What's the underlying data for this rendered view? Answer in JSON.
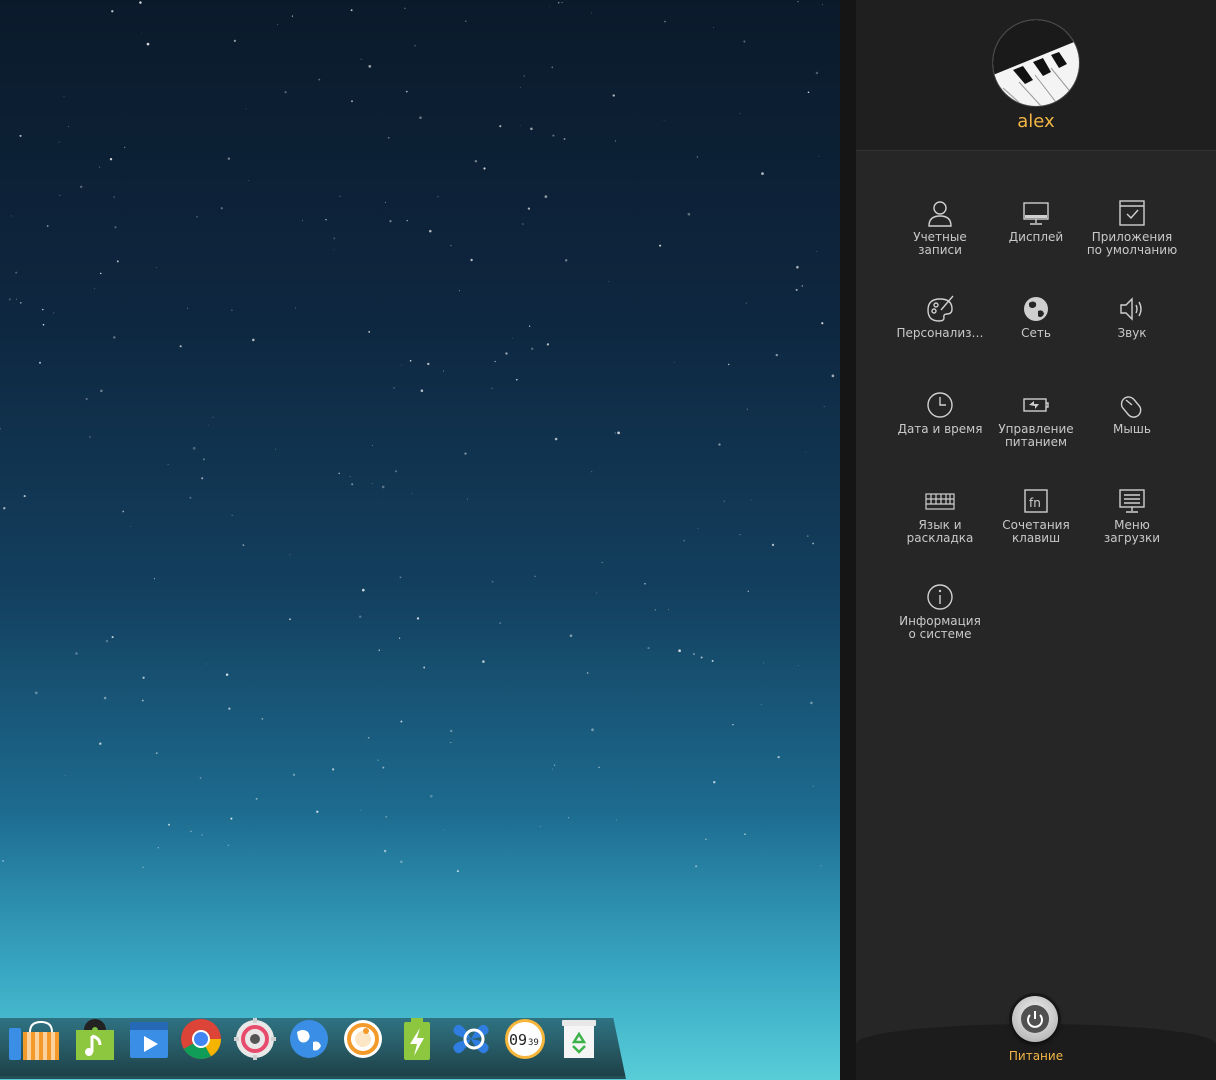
{
  "panel": {
    "username": "alex",
    "power_label": "Питание",
    "accent_color": "#f2b545",
    "modules": [
      {
        "label": "Учетные\nзаписи",
        "icon": "user-accounts-icon"
      },
      {
        "label": "Дисплей",
        "icon": "display-icon"
      },
      {
        "label": "Приложения\nпо умолчанию",
        "icon": "default-apps-icon"
      },
      {
        "label": "Персонализ…",
        "icon": "personalization-icon"
      },
      {
        "label": "Сеть",
        "icon": "network-icon"
      },
      {
        "label": "Звук",
        "icon": "sound-icon"
      },
      {
        "label": "Дата и время",
        "icon": "clock-icon"
      },
      {
        "label": "Управление\nпитанием",
        "icon": "battery-icon"
      },
      {
        "label": "Мышь",
        "icon": "mouse-icon"
      },
      {
        "label": "Язык и\nраскладка",
        "icon": "keyboard-icon"
      },
      {
        "label": "Сочетания\nклавиш",
        "icon": "fn-key-icon"
      },
      {
        "label": "Меню\nзагрузки",
        "icon": "boot-menu-icon"
      },
      {
        "label": "Информация\nо системе",
        "icon": "info-icon"
      }
    ]
  },
  "dock": {
    "clock_text": "09",
    "clock_minutes": "39",
    "apps": [
      "store-icon",
      "music-icon",
      "video-icon",
      "chrome-icon",
      "settings-icon",
      "browser-icon",
      "screenshot-icon",
      "power-manager-icon",
      "remote-icon",
      "clock-icon",
      "trash-icon"
    ]
  }
}
